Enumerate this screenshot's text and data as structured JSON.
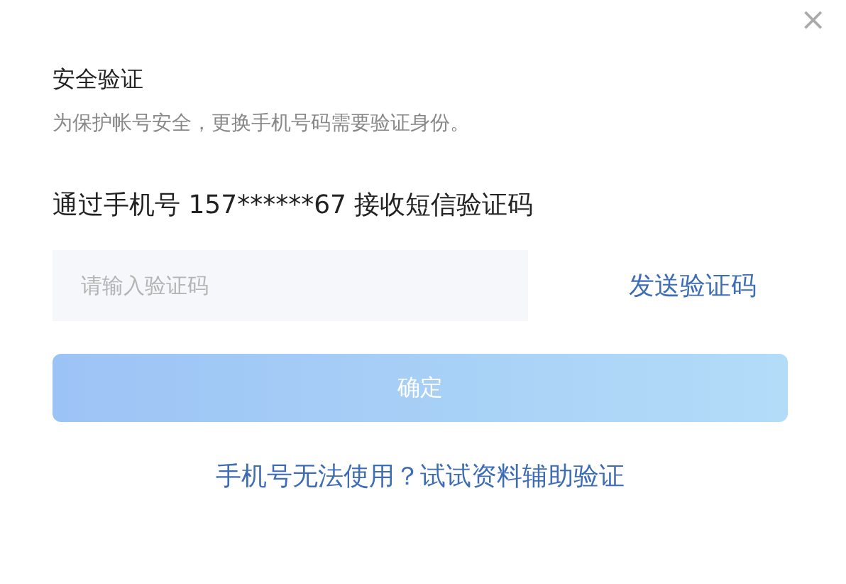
{
  "close": {
    "label": "×"
  },
  "title": "安全验证",
  "subtitle": "为保护帐号安全，更换手机号码需要验证身份。",
  "prompt": "通过手机号 157******67 接收短信验证码",
  "code_field": {
    "placeholder": "请输入验证码"
  },
  "send_link": "发送验证码",
  "confirm_button": {
    "label": "确定",
    "disabled": true
  },
  "alt_link": "手机号无法使用？试试资料辅助验证"
}
